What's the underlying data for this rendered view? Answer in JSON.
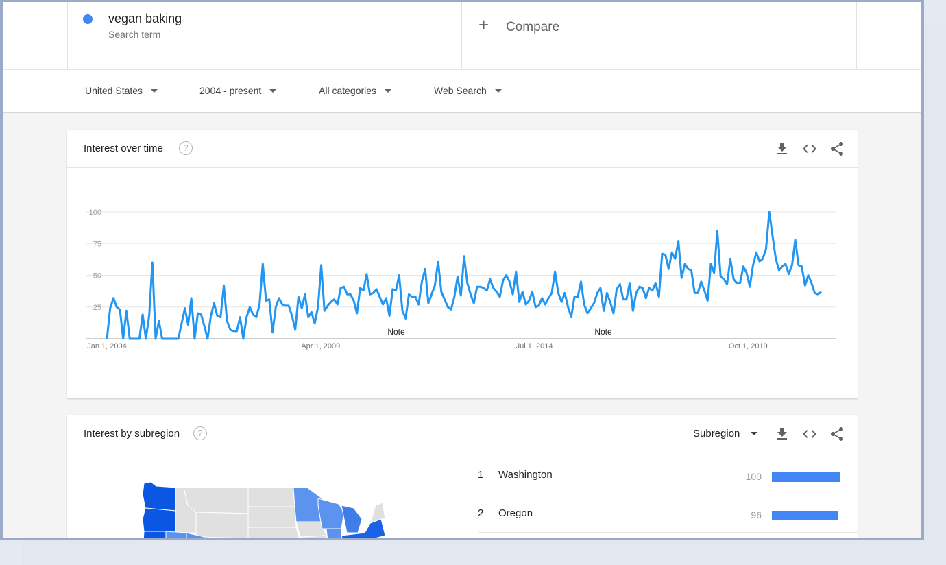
{
  "search": {
    "term": "vegan baking",
    "term_type": "Search term",
    "term_color": "#4285f4",
    "compare_label": "Compare"
  },
  "filters": [
    {
      "label": "United States"
    },
    {
      "label": "2004 - present"
    },
    {
      "label": "All categories"
    },
    {
      "label": "Web Search"
    }
  ],
  "interest_over_time": {
    "title": "Interest over time",
    "help": "?",
    "notes": [
      "Note",
      "Note"
    ]
  },
  "chart_data": {
    "type": "line",
    "title": "",
    "xlabel": "",
    "ylabel": "",
    "ylim": [
      0,
      100
    ],
    "yticks": [
      25,
      50,
      75,
      100
    ],
    "xtick_labels": [
      "Jan 1, 2004",
      "Apr 1, 2009",
      "Jul 1, 2014",
      "Oct 1, 2019"
    ],
    "xtick_dates": [
      "2004-01",
      "2009-04",
      "2014-07",
      "2019-10"
    ],
    "x_start": "2004-01",
    "x_end": "2021-12",
    "grid": true,
    "series": [
      {
        "name": "vegan baking",
        "color": "#2196f3",
        "values": [
          0,
          24,
          32,
          25,
          23,
          0,
          22,
          0,
          0,
          0,
          0,
          19,
          0,
          18,
          60,
          0,
          14,
          0,
          0,
          0,
          0,
          0,
          0,
          12,
          24,
          11,
          32,
          0,
          20,
          19,
          10,
          0,
          18,
          28,
          18,
          17,
          42,
          14,
          7,
          6,
          6,
          17,
          0,
          17,
          25,
          19,
          17,
          27,
          59,
          30,
          31,
          5,
          25,
          32,
          27,
          26,
          26,
          18,
          7,
          33,
          24,
          35,
          17,
          21,
          12,
          25,
          58,
          22,
          26,
          29,
          31,
          27,
          40,
          41,
          35,
          35,
          30,
          20,
          40,
          38,
          51,
          35,
          36,
          39,
          33,
          27,
          32,
          18,
          39,
          38,
          50,
          22,
          16,
          35,
          33,
          33,
          27,
          45,
          55,
          28,
          35,
          42,
          61,
          37,
          31,
          25,
          23,
          33,
          49,
          34,
          65,
          44,
          35,
          28,
          41,
          41,
          40,
          38,
          47,
          40,
          37,
          33,
          46,
          50,
          45,
          35,
          53,
          29,
          37,
          27,
          30,
          37,
          25,
          26,
          32,
          27,
          32,
          36,
          53,
          36,
          29,
          36,
          25,
          17,
          33,
          33,
          45,
          27,
          20,
          24,
          28,
          36,
          40,
          22,
          36,
          29,
          20,
          39,
          43,
          31,
          31,
          44,
          22,
          36,
          41,
          40,
          32,
          40,
          38,
          44,
          33,
          67,
          66,
          55,
          68,
          63,
          77,
          48,
          59,
          55,
          54,
          36,
          36,
          45,
          38,
          30,
          59,
          52,
          85,
          49,
          47,
          43,
          63,
          47,
          44,
          44,
          57,
          52,
          41,
          58,
          68,
          61,
          63,
          71,
          100,
          81,
          63,
          54,
          57,
          59,
          51,
          58,
          78,
          58,
          57,
          42,
          50,
          44,
          36,
          35,
          37
        ]
      }
    ]
  },
  "interest_by_subregion": {
    "title": "Interest by subregion",
    "help": "?",
    "resolution_label": "Subregion",
    "rows": [
      {
        "rank": "1",
        "name": "Washington",
        "value": 100
      },
      {
        "rank": "2",
        "name": "Oregon",
        "value": 96
      }
    ]
  },
  "icons": [
    "download-icon",
    "embed-code-icon",
    "share-icon",
    "help-icon",
    "plus-icon",
    "caret-down-icon"
  ]
}
